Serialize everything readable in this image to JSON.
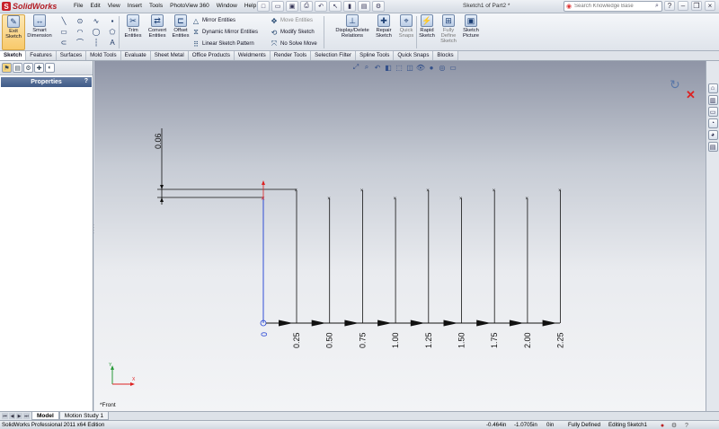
{
  "app": {
    "name": "SolidWorks",
    "doc_title": "Sketch1 of Part2 *"
  },
  "menu": [
    "File",
    "Edit",
    "View",
    "Insert",
    "Tools",
    "PhotoView 360",
    "Window",
    "Help"
  ],
  "search": {
    "placeholder": "Search Knowledge Base"
  },
  "toolbar": {
    "exit_sketch": "Exit Sketch",
    "smart_dimension": "Smart Dimension",
    "trim_entities": "Trim Entities",
    "convert_entities": "Convert Entities",
    "offset_entities": "Offset Entities",
    "mirror_entities": "Mirror Entities",
    "dynamic_mirror": "Dynamic Mirror Entities",
    "linear_pattern": "Linear Sketch Pattern",
    "move_entities": "Move Entities",
    "modify_sketch": "Modify Sketch",
    "no_solve_move": "No Solve Move",
    "display_delete_relations": "Display/Delete Relations",
    "repair_sketch": "Repair Sketch",
    "quick_snaps": "Quick Snaps",
    "rapid_sketch": "Rapid Sketch",
    "fully_define_sketch": "Fully Define Sketch",
    "sketch_picture": "Sketch Picture"
  },
  "tabs": [
    "Sketch",
    "Features",
    "Surfaces",
    "Mold Tools",
    "Evaluate",
    "Sheet Metal",
    "Office Products",
    "Weldments",
    "Render Tools",
    "Selection Filter",
    "Spline Tools",
    "Quick Snaps",
    "Blocks"
  ],
  "panel": {
    "header": "Properties",
    "help": "?"
  },
  "sketch": {
    "vertical_dimension": "0.06",
    "origin_label": "0",
    "x_labels": [
      "0.25",
      "0.50",
      "0.75",
      "1.00",
      "1.25",
      "1.50",
      "1.75",
      "2.00",
      "2.25"
    ],
    "view_label": "*Front"
  },
  "bottom_tabs": [
    "Model",
    "Motion Study 1"
  ],
  "status": {
    "edition": "SolidWorks Professional 2011 x64 Edition",
    "x": "-0.464in",
    "y": "-1.0705in",
    "z": "0in",
    "state": "Fully Defined",
    "editing": "Editing Sketch1"
  },
  "colors": {
    "accent": "#c8202a",
    "sketch_blue": "#1f3fd4",
    "sketch_line": "#111111"
  },
  "icons": {
    "exit_sketch": "exit-sketch-icon",
    "smart_dimension": "smart-dimension-icon",
    "search": "search-icon",
    "confirm_ok": "confirm-ok-icon",
    "cancel": "cancel-icon"
  }
}
